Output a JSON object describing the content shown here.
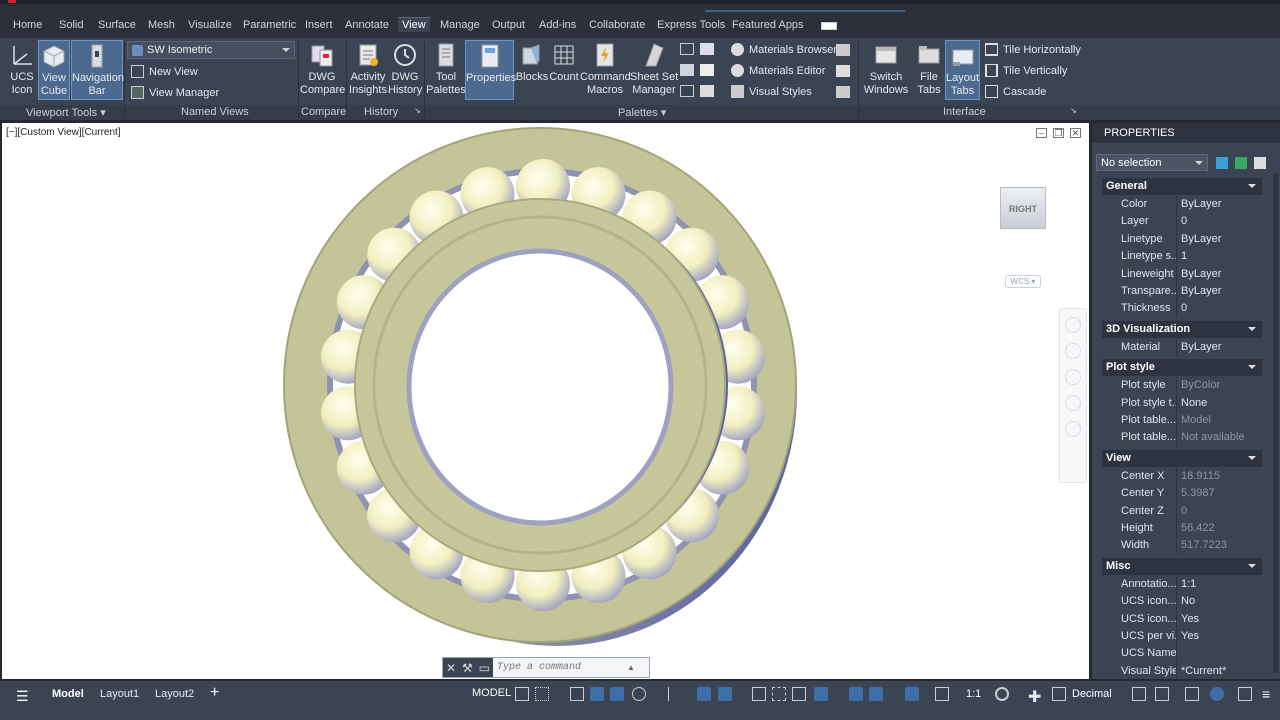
{
  "ribbon_tabs": [
    "Home",
    "Solid",
    "Surface",
    "Mesh",
    "Visualize",
    "Parametric",
    "Insert",
    "Annotate",
    "View",
    "Manage",
    "Output",
    "Add-ins",
    "Collaborate",
    "Express Tools",
    "Featured Apps"
  ],
  "active_tab": "View",
  "viewport_tools": {
    "ucs_icon": "UCS\nIcon",
    "view_cube": "View\nCube",
    "navigation_bar": "Navigation\nBar",
    "panel_label": "Viewport Tools"
  },
  "named_views": {
    "current_view": "SW Isometric",
    "new_view": "New View",
    "view_manager": "View Manager",
    "panel_label": "Named Views"
  },
  "compare": {
    "dwg_compare": "DWG\nCompare",
    "panel_label": "Compare"
  },
  "history": {
    "activity_insights": "Activity\nInsights",
    "dwg_history": "DWG\nHistory",
    "panel_label": "History"
  },
  "palettes": {
    "tool_palettes": "Tool\nPalettes",
    "properties": "Properties",
    "blocks": "Blocks",
    "count": "Count",
    "command_macros": "Command\nMacros",
    "sheet_set_manager": "Sheet Set\nManager",
    "materials_browser": "Materials Browser",
    "materials_editor": "Materials Editor",
    "visual_styles": "Visual Styles",
    "panel_label": "Palettes"
  },
  "interface": {
    "switch_windows": "Switch\nWindows",
    "file_tabs": "File\nTabs",
    "layout_tabs": "Layout\nTabs",
    "tile_horizontally": "Tile Horizontally",
    "tile_vertically": "Tile Vertically",
    "cascade": "Cascade",
    "panel_label": "Interface"
  },
  "viewport": {
    "label": "[−][Custom View][Current]",
    "viewcube_face": "RIGHT",
    "wcs": "WCS"
  },
  "command_line": {
    "placeholder": "Type a command"
  },
  "properties_palette": {
    "title": "PROPERTIES",
    "selection": "No selection",
    "sections": [
      {
        "name": "General",
        "rows": [
          [
            "Color",
            "ByLayer"
          ],
          [
            "Layer",
            "0"
          ],
          [
            "Linetype",
            "ByLayer"
          ],
          [
            "Linetype s...",
            "1"
          ],
          [
            "Lineweight",
            "ByLayer"
          ],
          [
            "Transpare...",
            "ByLayer"
          ],
          [
            "Thickness",
            "0"
          ]
        ]
      },
      {
        "name": "3D Visualization",
        "rows": [
          [
            "Material",
            "ByLayer"
          ]
        ]
      },
      {
        "name": "Plot style",
        "rows": [
          [
            "Plot style",
            "ByColor"
          ],
          [
            "Plot style t...",
            "None"
          ],
          [
            "Plot table...",
            "Model"
          ],
          [
            "Plot table...",
            "Not available"
          ]
        ]
      },
      {
        "name": "View",
        "rows": [
          [
            "Center X",
            "18.9115"
          ],
          [
            "Center Y",
            "5.3987"
          ],
          [
            "Center Z",
            "0"
          ],
          [
            "Height",
            "56.422"
          ],
          [
            "Width",
            "517.7223"
          ]
        ]
      },
      {
        "name": "Misc",
        "rows": [
          [
            "Annotatio...",
            "1:1"
          ],
          [
            "UCS icon...",
            "No"
          ],
          [
            "UCS icon...",
            "Yes"
          ],
          [
            "UCS per vi...",
            "Yes"
          ],
          [
            "UCS Name",
            ""
          ],
          [
            "Visual Style",
            "*Current*"
          ]
        ]
      }
    ]
  },
  "layout_tabs": [
    "Model",
    "Layout1",
    "Layout2"
  ],
  "status": {
    "model": "MODEL",
    "scale": "1:1",
    "units": "Decimal"
  },
  "colors": {
    "ribbon_bg": "#3b4453",
    "accent": "#3e6ea8",
    "viewport_bg": "#ffffff",
    "bearing_ring": "#c5c8a0",
    "bearing_ball": "#f0f0c0"
  }
}
